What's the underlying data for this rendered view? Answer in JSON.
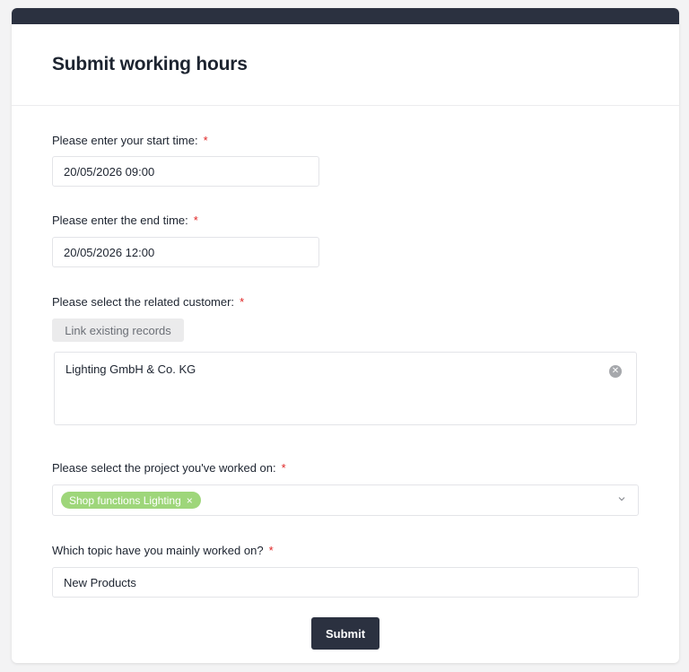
{
  "form": {
    "title": "Submit working hours",
    "start_time": {
      "label": "Please enter your start time:",
      "required_marker": "*",
      "value": "20/05/2026 09:00"
    },
    "end_time": {
      "label": "Please enter the end time:",
      "required_marker": "*",
      "value": "20/05/2026 12:00"
    },
    "customer": {
      "label": "Please select the related customer:",
      "required_marker": "*",
      "link_button": "Link existing records",
      "selected_record": "Lighting GmbH & Co. KG",
      "clear_icon": "clear-circle-icon"
    },
    "project": {
      "label": "Please select the project you've worked on:",
      "required_marker": "*",
      "selected_tags": [
        {
          "label": "Shop functions Lighting",
          "remove_glyph": "×",
          "color": "#9ed67a"
        }
      ],
      "dropdown_icon": "chevron-down-icon"
    },
    "topic": {
      "label": "Which topic have you mainly worked on?",
      "required_marker": "*",
      "value": "New Products"
    },
    "submit_label": "Submit"
  },
  "colors": {
    "accent_dark": "#2b3140",
    "required": "#e02424",
    "tag_green": "#9ed67a"
  }
}
